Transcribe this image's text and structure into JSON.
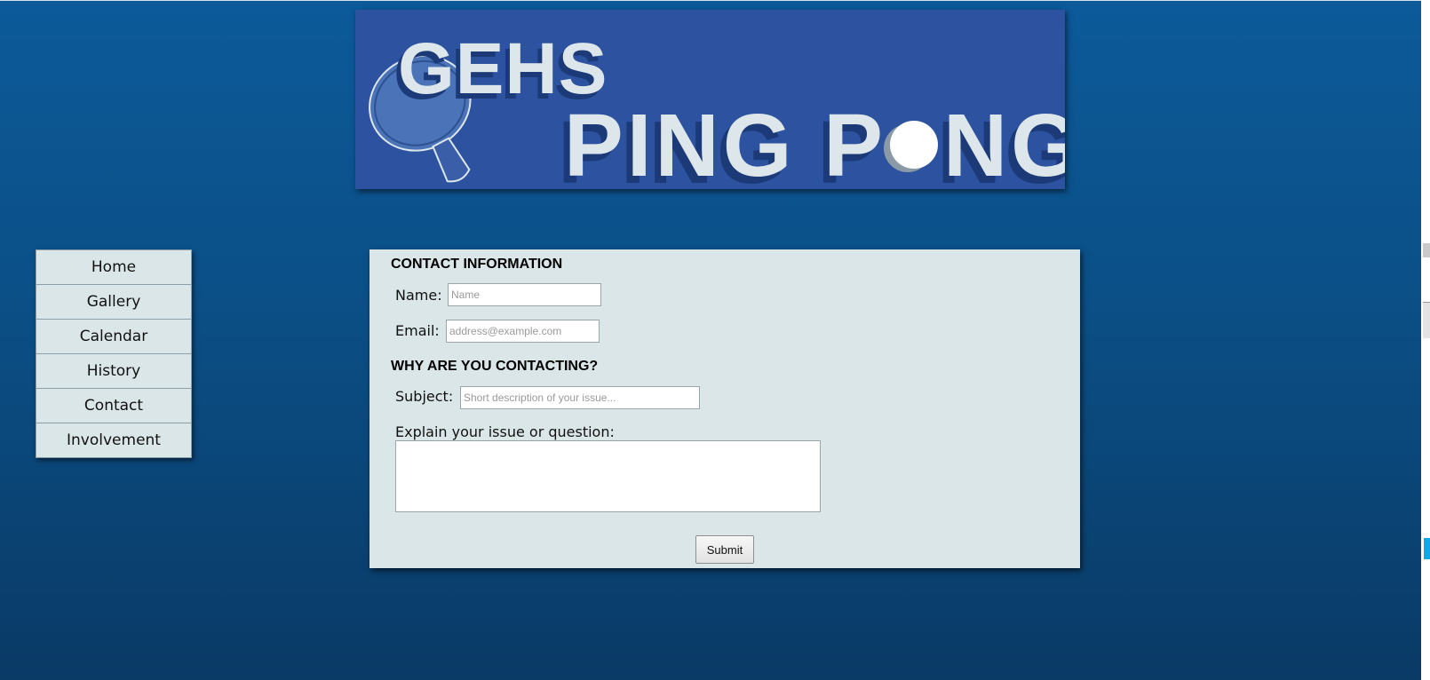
{
  "banner": {
    "title_line1": "GEHS",
    "title_line2_part1": "PING P",
    "title_line2_part2": "NG"
  },
  "nav": {
    "items": [
      {
        "label": "Home"
      },
      {
        "label": "Gallery"
      },
      {
        "label": "Calendar"
      },
      {
        "label": "History"
      },
      {
        "label": "Contact"
      },
      {
        "label": "Involvement"
      }
    ]
  },
  "form": {
    "contact_heading": "CONTACT INFORMATION",
    "name_label": "Name:",
    "name_placeholder": "Name",
    "email_label": "Email:",
    "email_placeholder": "address@example.com",
    "reason_heading": "WHY ARE YOU CONTACTING?",
    "subject_label": "Subject:",
    "subject_placeholder": "Short description of your issue...",
    "explain_label": "Explain your issue or question:",
    "submit_label": "Submit"
  },
  "colors": {
    "background": "#0b5290",
    "panel": "#dae6e8",
    "banner": "#2c52a0"
  }
}
